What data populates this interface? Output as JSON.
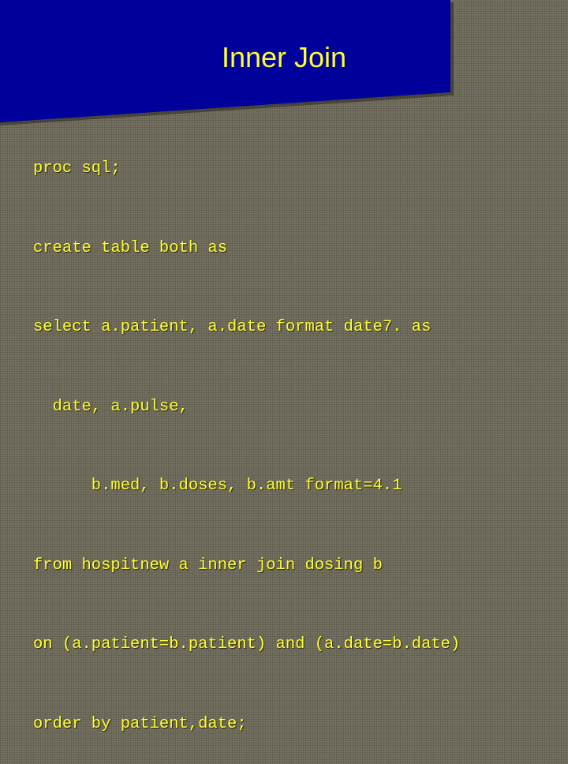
{
  "slide": {
    "title": "Inner Join",
    "code_lines": [
      "proc sql;",
      "create table both as",
      "select a.patient, a.date format date7. as",
      "  date, a.pulse,",
      "      b.med, b.doses, b.amt format=4.1",
      "from hospitnew a inner join dosing b",
      "on (a.patient=b.patient) and (a.date=b.date)",
      "order by patient,date;"
    ]
  },
  "colors": {
    "title_panel": "#00009a",
    "text": "#ffff33",
    "background": "#6c6757"
  }
}
